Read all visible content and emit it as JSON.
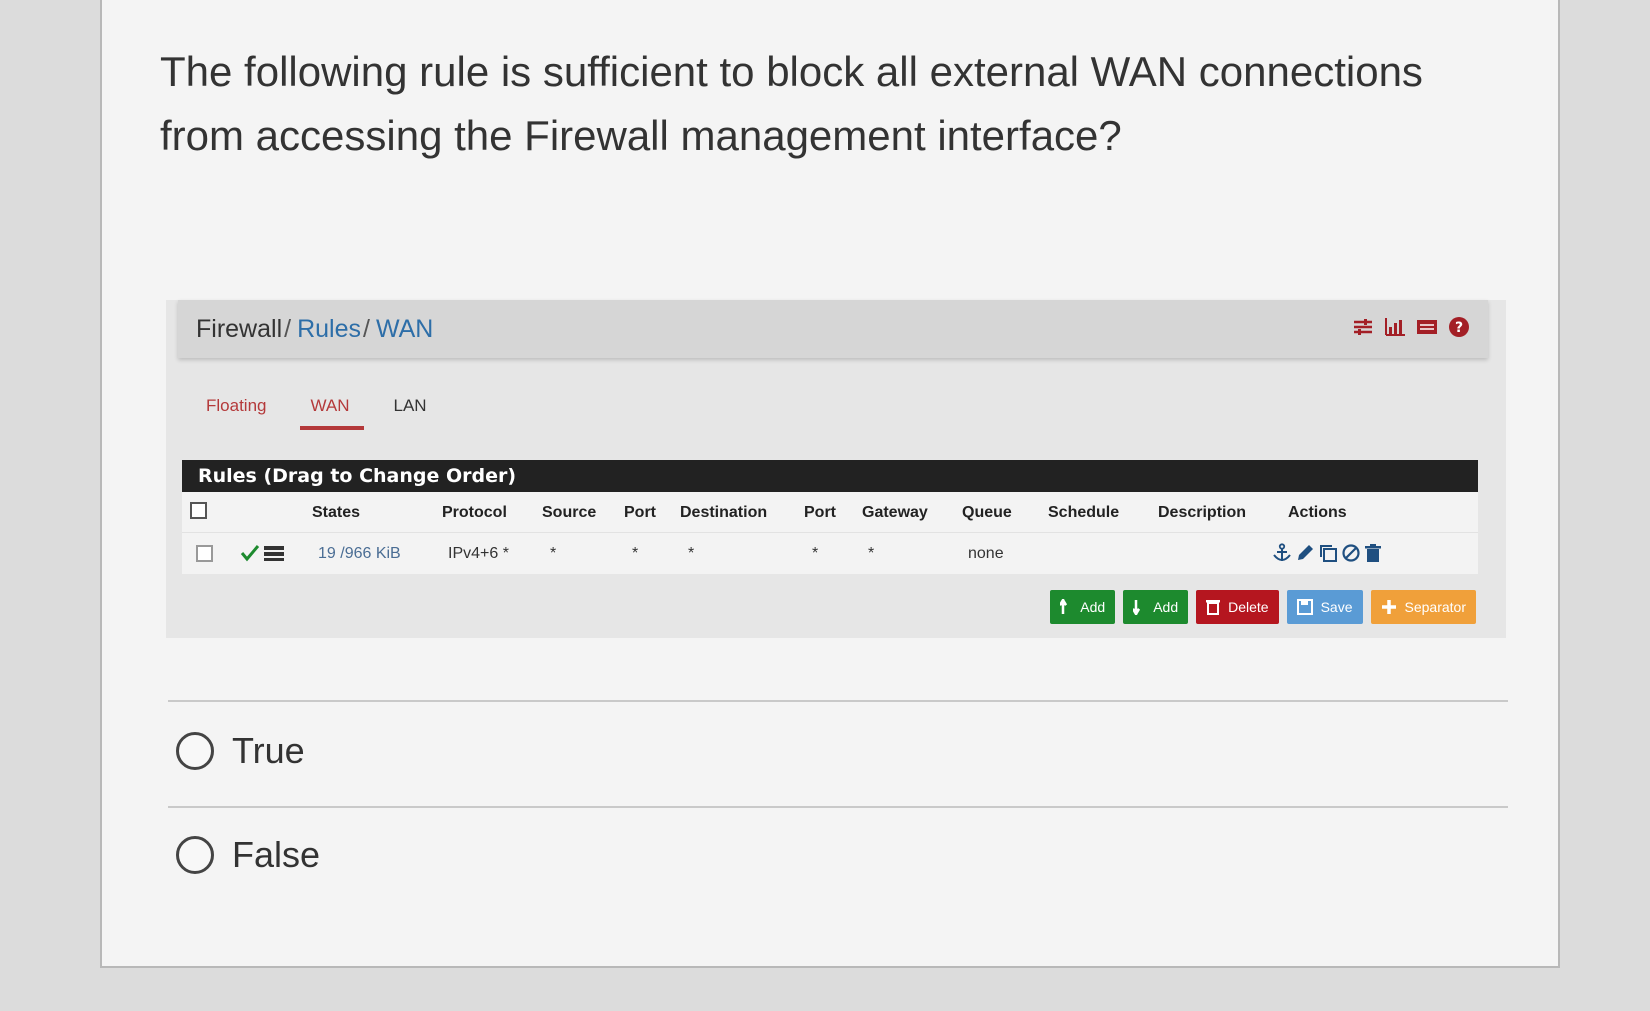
{
  "question": {
    "text": "The following rule is sufficient to block all external WAN connections from accessing the Firewall management interface?"
  },
  "breadcrumb": {
    "items": [
      "Firewall",
      "Rules",
      "WAN"
    ],
    "separator": "/",
    "icons": [
      "sliders-icon",
      "bar-chart-icon",
      "list-icon",
      "help-icon"
    ]
  },
  "tabs": [
    {
      "label": "Floating",
      "active": false
    },
    {
      "label": "WAN",
      "active": true
    },
    {
      "label": "LAN",
      "active": false
    }
  ],
  "rules_table": {
    "title": "Rules (Drag to Change Order)",
    "columns": [
      "States",
      "Protocol",
      "Source",
      "Port",
      "Destination",
      "Port",
      "Gateway",
      "Queue",
      "Schedule",
      "Description",
      "Actions"
    ],
    "rows": [
      {
        "states": "19 /966 KiB",
        "protocol": "IPv4+6 *",
        "source": "*",
        "source_port": "*",
        "destination": "*",
        "destination_port": "*",
        "gateway": "*",
        "queue": "none",
        "schedule": "",
        "description": ""
      }
    ]
  },
  "buttons": {
    "add_top": "Add",
    "add_bottom": "Add",
    "delete": "Delete",
    "save": "Save",
    "separator": "Separator"
  },
  "answers": [
    {
      "label": "True"
    },
    {
      "label": "False"
    }
  ],
  "colors": {
    "link": "#2d6ea8",
    "tab_active": "#b4393a",
    "green": "#1d8a2e",
    "red": "#b5161f",
    "blue": "#5a9bd5",
    "orange": "#f0a03a"
  }
}
